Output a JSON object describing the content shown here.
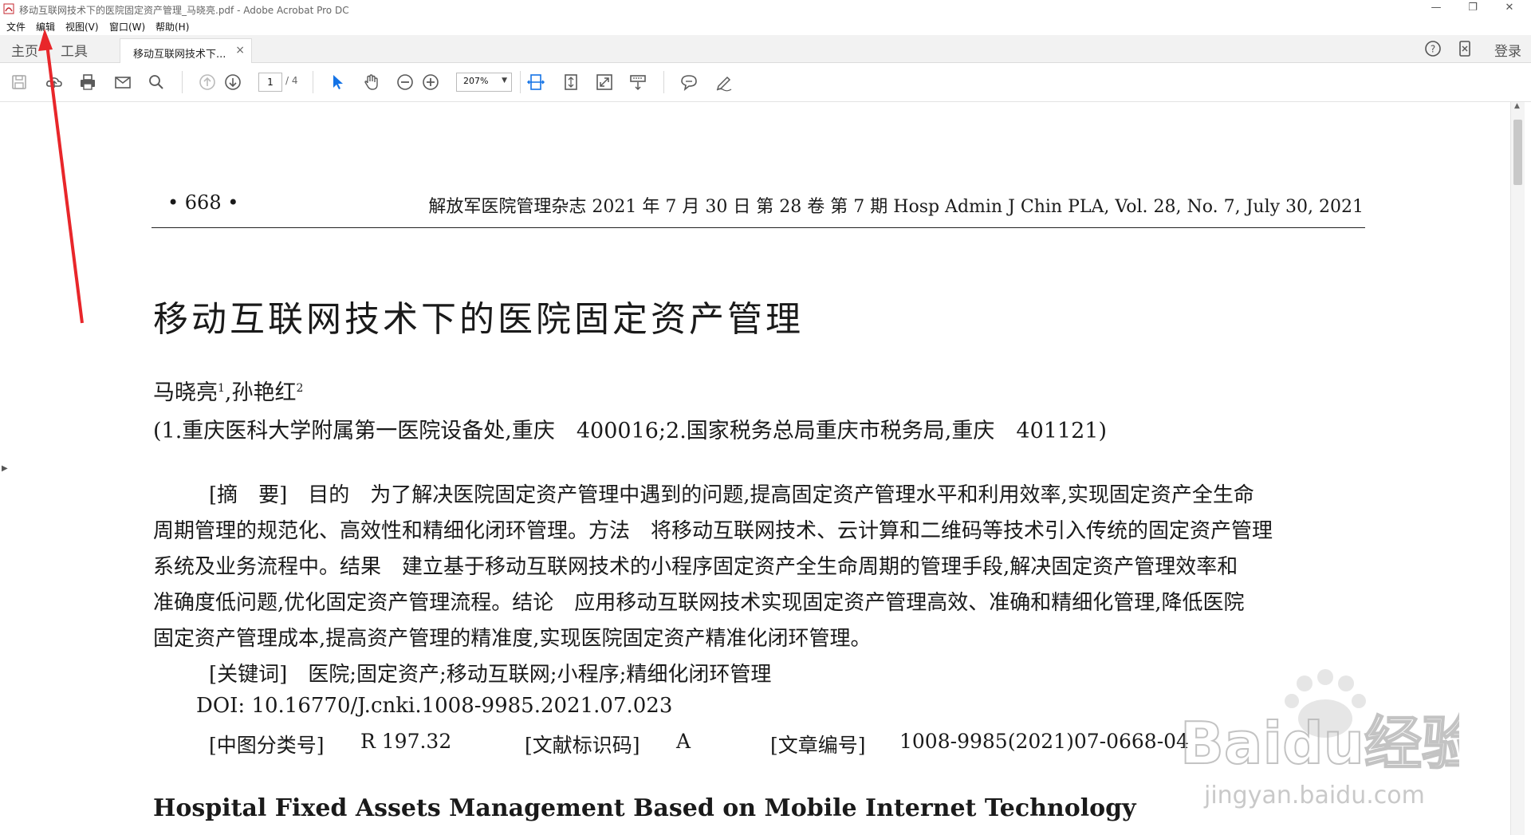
{
  "window": {
    "title": "移动互联网技术下的医院固定资产管理_马晓亮.pdf - Adobe Acrobat Pro DC",
    "min_glyph": "—",
    "restore_glyph": "❐",
    "close_glyph": "✕"
  },
  "menu": {
    "items": [
      "文件",
      "编辑",
      "视图(V)",
      "窗口(W)",
      "帮助(H)"
    ]
  },
  "tabs": {
    "home": "主页",
    "tools": "工具",
    "document": "移动互联网技术下...",
    "close_glyph": "×",
    "login": "登录"
  },
  "toolbar": {
    "page_current": "1",
    "page_total": "/ 4",
    "zoom": "207%",
    "icons": [
      "save-icon",
      "cloud-upload-icon",
      "print-icon",
      "email-icon",
      "search-icon",
      "prev-page-icon",
      "next-page-icon",
      "select-cursor-icon",
      "hand-tool-icon",
      "zoom-out-icon",
      "zoom-in-icon",
      "fit-width-icon",
      "fit-page-icon",
      "full-screen-icon",
      "scroll-mode-icon",
      "comment-icon",
      "sign-icon"
    ]
  },
  "doc": {
    "page_number": "• 668 •",
    "journal_header": "解放军医院管理杂志 2021 年 7 月 30 日 第 28 卷 第 7 期 Hosp Admin J Chin PLA, Vol. 28, No. 7, July 30, 2021",
    "title": "移动互联网技术下的医院固定资产管理",
    "author1": "马晓亮",
    "author1_sup": "1",
    "author_sep": ",孙艳红",
    "author2_sup": "2",
    "affiliation": "(1.重庆医科大学附属第一医院设备处,重庆　400016;2.国家税务总局重庆市税务局,重庆　401121)",
    "abstract_lines": [
      "[摘　要]　目的　为了解决医院固定资产管理中遇到的问题,提高固定资产管理水平和利用效率,实现固定资产全生命",
      "周期管理的规范化、高效性和精细化闭环管理。方法　将移动互联网技术、云计算和二维码等技术引入传统的固定资产管理",
      "系统及业务流程中。结果　建立基于移动互联网技术的小程序固定资产全生命周期的管理手段,解决固定资产管理效率和",
      "准确度低问题,优化固定资产管理流程。结论　应用移动互联网技术实现固定资产管理高效、准确和精细化管理,降低医院",
      "固定资产管理成本,提高资产管理的精准度,实现医院固定资产精准化闭环管理。"
    ],
    "keywords": "[关键词]　医院;固定资产;移动互联网;小程序;精细化闭环管理",
    "doi": "DOI: 10.16770/J.cnki.1008-9985.2021.07.023",
    "clc_label": "[中图分类号]",
    "clc_value": "R 197.32",
    "docid_label": "[文献标识码]",
    "docid_value": "A",
    "article_label": "[文章编号]",
    "article_value": "1008-9985(2021)07-0668-04",
    "english_title": "Hospital Fixed Assets Management Based on Mobile Internet Technology"
  },
  "annotation": {
    "arrow_color": "#e8262a",
    "watermark_text": "Baidu经验",
    "watermark_url": "jingyan.baidu.com"
  },
  "colors": {
    "accent_blue": "#1473e6",
    "toolbar_icon": "#5a5a5a",
    "tabbar_bg": "#f2f2f2"
  }
}
